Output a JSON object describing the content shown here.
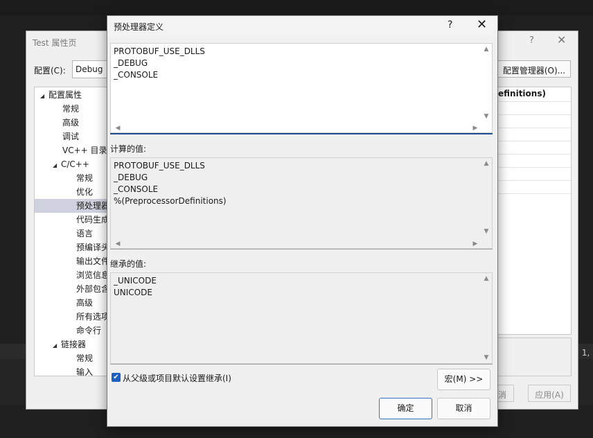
{
  "background": {
    "right_text": ": 1,"
  },
  "property_page": {
    "title": "Test 属性页",
    "help": "?",
    "close": "✕",
    "config_label": "配置(C):",
    "config_value": "Debug",
    "config_manager": "配置管理器(O)...",
    "grid_header": "efinitions)",
    "tree": [
      {
        "label": "配置属性",
        "arrow": "◢",
        "indent": 0
      },
      {
        "label": "常规",
        "indent": 2
      },
      {
        "label": "高级",
        "indent": 2
      },
      {
        "label": "调试",
        "indent": 2
      },
      {
        "label": "VC++ 目录",
        "indent": 2
      },
      {
        "label": "C/C++",
        "arrow": "◢",
        "indent": 1
      },
      {
        "label": "常规",
        "indent": 3
      },
      {
        "label": "优化",
        "indent": 3
      },
      {
        "label": "预处理器",
        "indent": 3,
        "selected": true
      },
      {
        "label": "代码生成",
        "indent": 3
      },
      {
        "label": "语言",
        "indent": 3
      },
      {
        "label": "预编译头",
        "indent": 3
      },
      {
        "label": "输出文件",
        "indent": 3
      },
      {
        "label": "浏览信息",
        "indent": 3
      },
      {
        "label": "外部包含",
        "indent": 3
      },
      {
        "label": "高级",
        "indent": 3
      },
      {
        "label": "所有选项",
        "indent": 3
      },
      {
        "label": "命令行",
        "indent": 3
      },
      {
        "label": "链接器",
        "arrow": "◢",
        "indent": 1
      },
      {
        "label": "常规",
        "indent": 3
      },
      {
        "label": "输入",
        "indent": 3
      }
    ],
    "cancel_partial": "消",
    "apply": "应用(A)"
  },
  "dialog": {
    "title": "预处理器定义",
    "help": "?",
    "close": "✕",
    "edit_lines": [
      "PROTOBUF_USE_DLLS",
      "_DEBUG",
      "_CONSOLE"
    ],
    "computed_label": "计算的值:",
    "computed_lines": [
      "PROTOBUF_USE_DLLS",
      "_DEBUG",
      "_CONSOLE",
      "%(PreprocessorDefinitions)"
    ],
    "inherited_label": "继承的值:",
    "inherited_lines": [
      "_UNICODE",
      "UNICODE"
    ],
    "inherit_checkbox_label": "从父级或项目默认设置继承(I)",
    "inherit_checked": true,
    "macro_button": "宏(M) >>",
    "ok_button": "确定",
    "cancel_button": "取消",
    "colors": {
      "accent": "#1f5fbf",
      "focus_underline": "#1f4f8f"
    }
  }
}
